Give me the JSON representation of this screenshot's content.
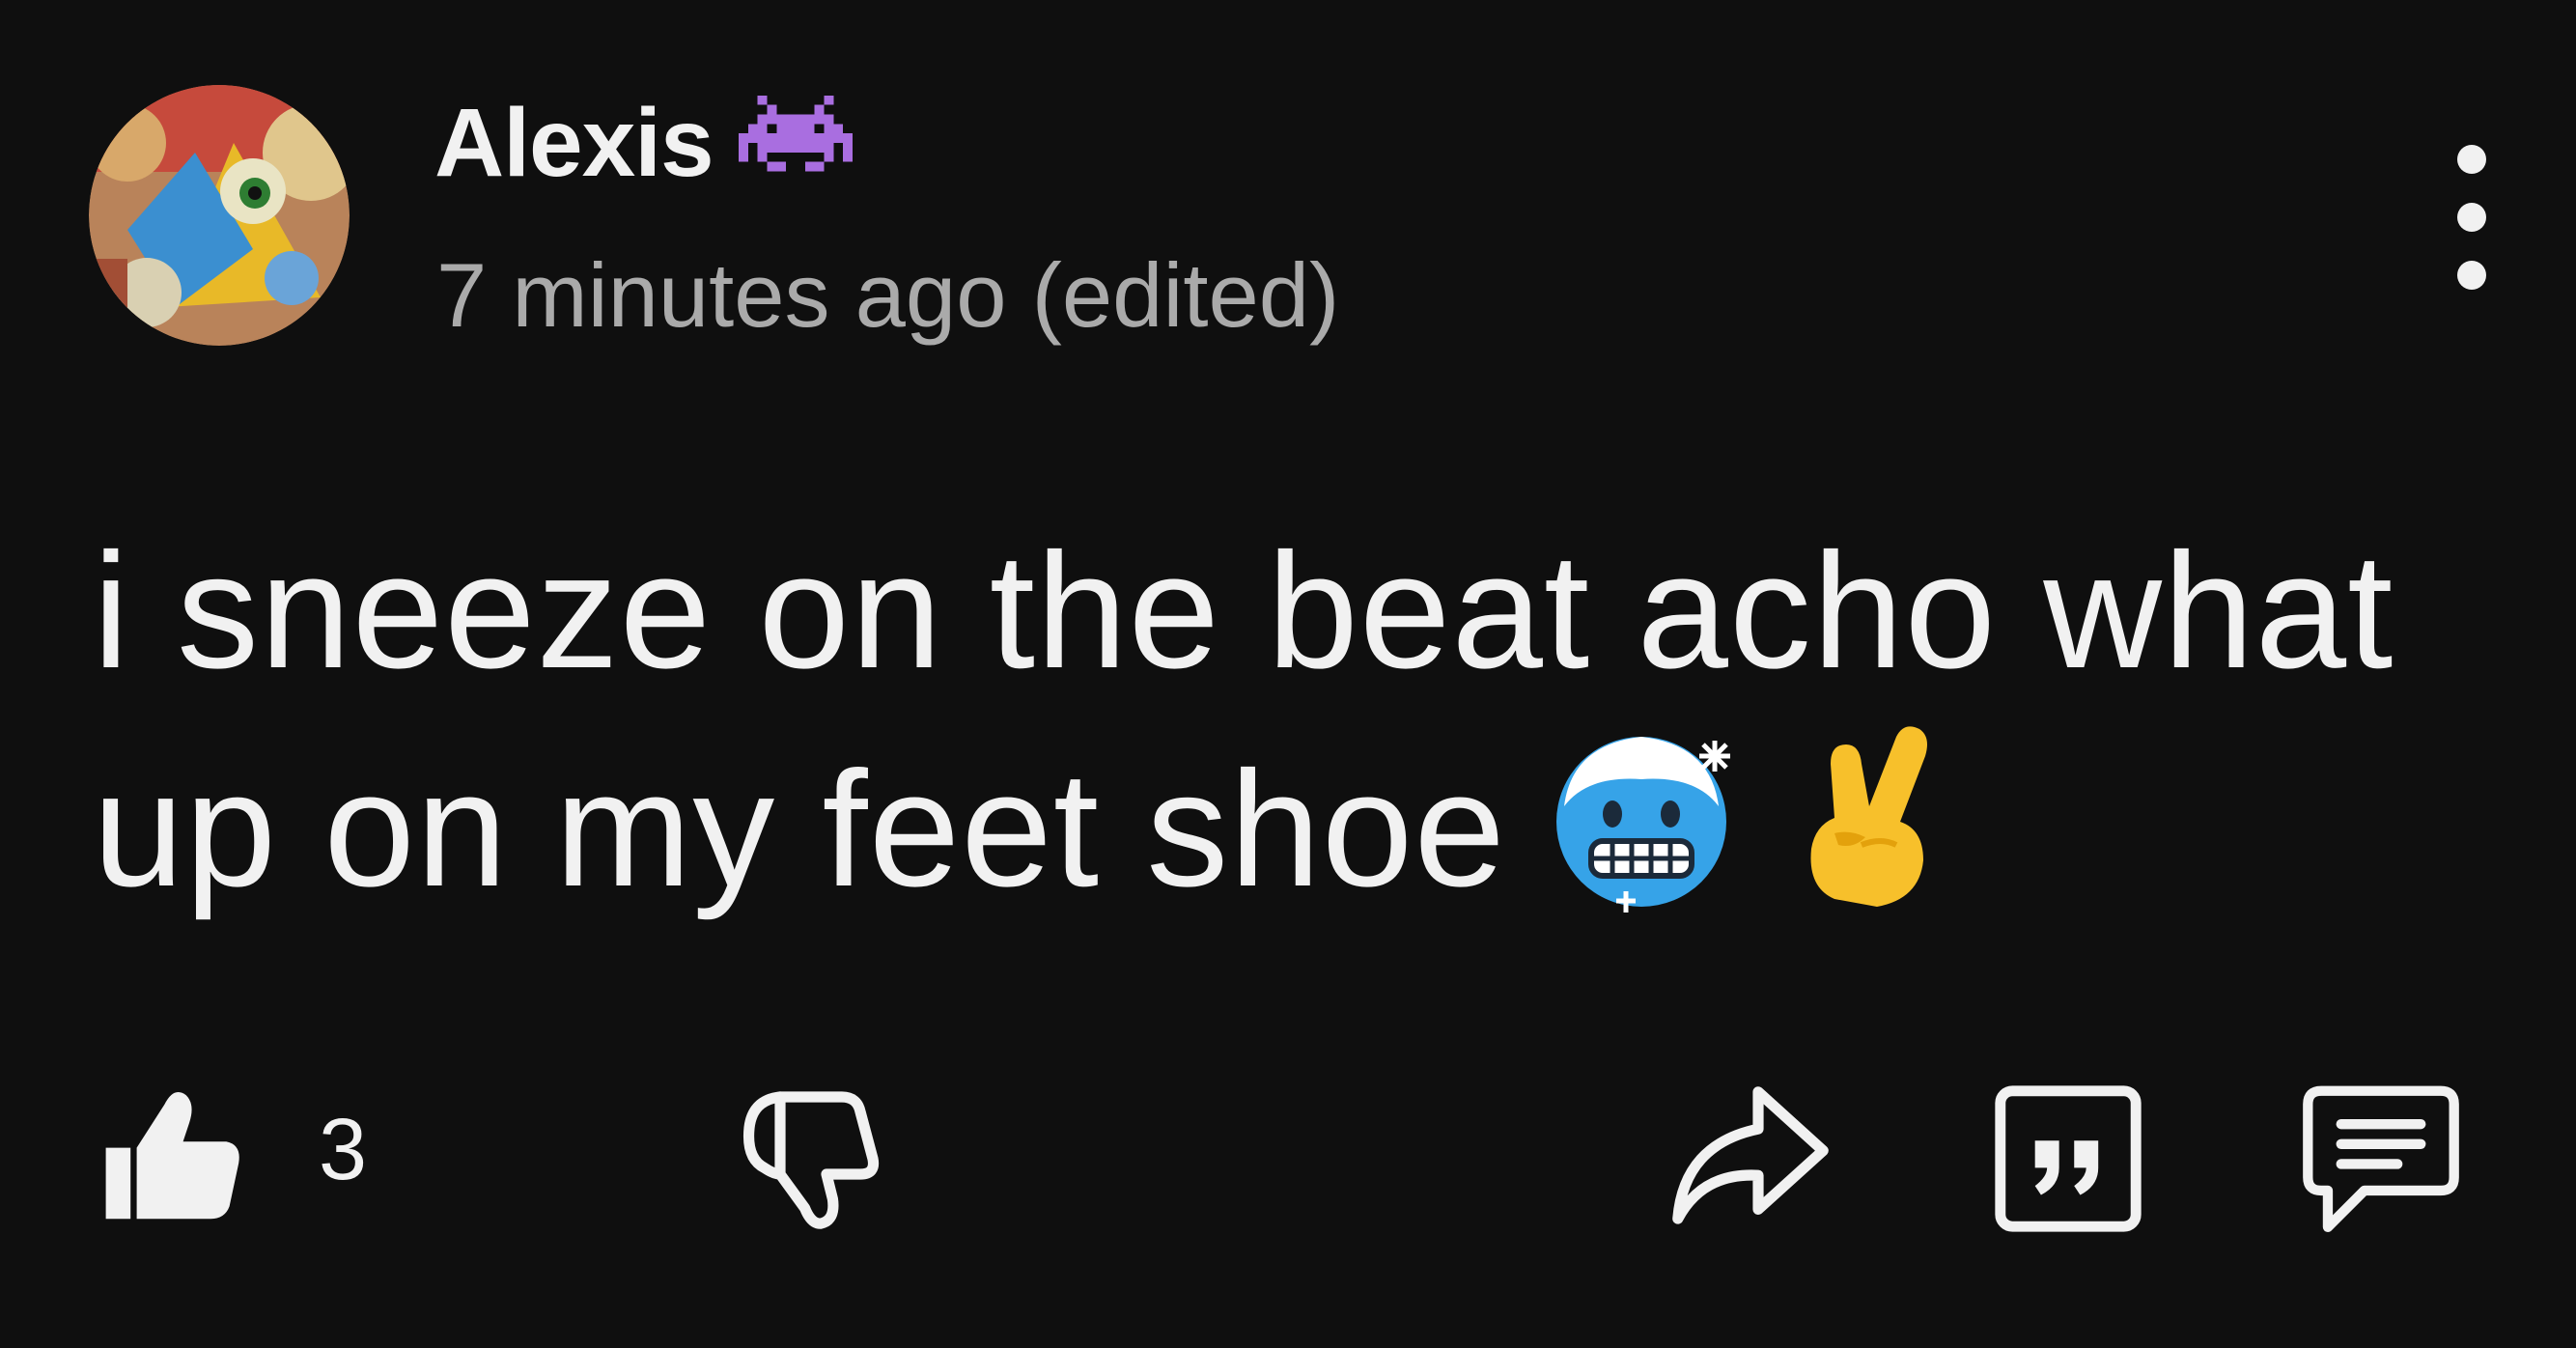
{
  "comment": {
    "author": "Alexis",
    "author_badge_icon": "space-invader-icon",
    "timestamp": "7 minutes ago (edited)",
    "text": "i sneeze on the beat acho what up on my feet shoe",
    "trailing_emojis": [
      "cold-face-emoji",
      "victory-hand-emoji"
    ],
    "like_count": "3"
  },
  "actions": {
    "like_icon": "thumbs-up-icon",
    "dislike_icon": "thumbs-down-icon",
    "share_icon": "share-arrow-icon",
    "quote_icon": "quote-icon",
    "reply_icon": "reply-icon",
    "menu_icon": "vertical-dots-icon"
  },
  "colors": {
    "background": "#0f0f0f",
    "text": "#f1f1f1",
    "secondary_text": "#aaaaaa",
    "badge": "#a96ee0"
  }
}
